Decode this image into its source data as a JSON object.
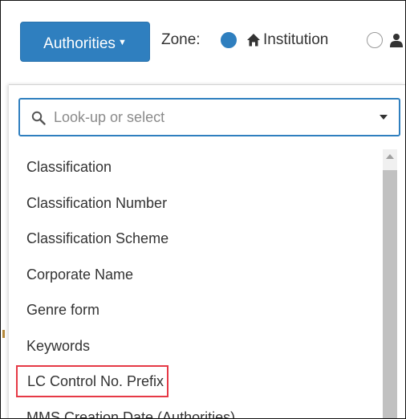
{
  "toolbar": {
    "authorities_label": "Authorities",
    "authorities_caret": "▼",
    "zone_label": "Zone:",
    "zone_options": [
      {
        "label": "Institution",
        "icon": "home-icon",
        "selected": true
      },
      {
        "label": "",
        "icon": "person-icon",
        "selected": false
      }
    ],
    "accent_color": "#2f7fbf"
  },
  "dropdown": {
    "search": {
      "placeholder": "Look-up or select",
      "value": ""
    },
    "options": [
      {
        "label": "Classification"
      },
      {
        "label": "Classification Number"
      },
      {
        "label": "Classification Scheme"
      },
      {
        "label": "Corporate Name"
      },
      {
        "label": "Genre form"
      },
      {
        "label": "Keywords"
      },
      {
        "label": "LC Control No. Prefix",
        "highlighted": true,
        "highlight_color": "#e63946"
      },
      {
        "label": "MMS Creation Date (Authorities)"
      }
    ]
  }
}
